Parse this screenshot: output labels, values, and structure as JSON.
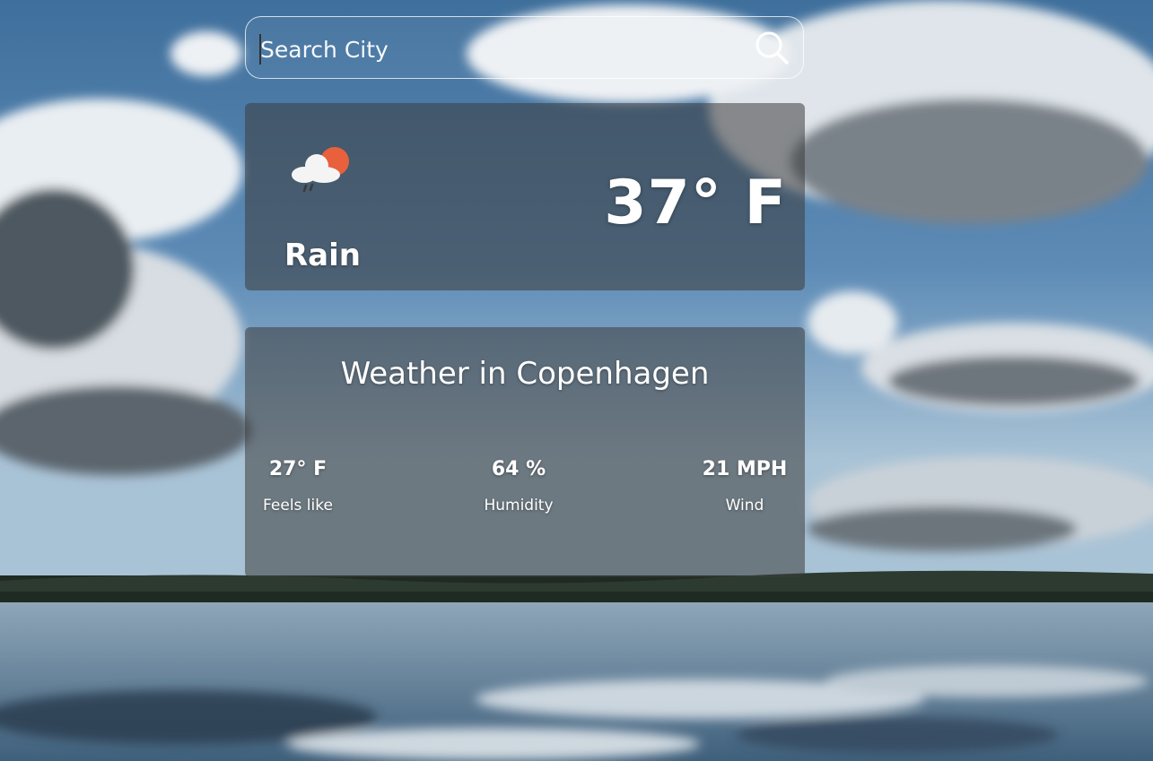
{
  "search": {
    "placeholder": "Search City",
    "value": ""
  },
  "current": {
    "icon": "rain-cloud-sun-icon",
    "condition": "Rain",
    "temperature": "37° F"
  },
  "details": {
    "title": "Weather in Copenhagen",
    "feels_like": {
      "value": "27° F",
      "label": "Feels like"
    },
    "humidity": {
      "value": "64 %",
      "label": "Humidity"
    },
    "wind": {
      "value": "21 MPH",
      "label": "Wind"
    }
  },
  "colors": {
    "sky": "#5a88b4",
    "card": "#3c3c3c",
    "sun": "#e8603c",
    "text": "#ffffff"
  }
}
